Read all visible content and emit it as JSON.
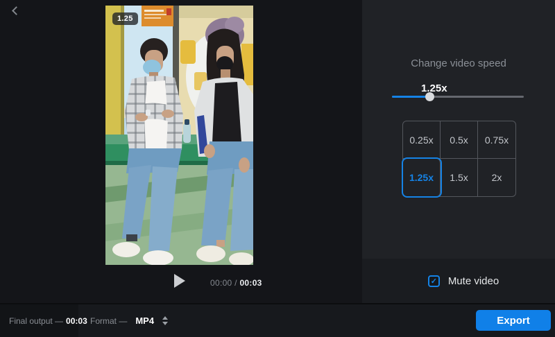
{
  "colors": {
    "accent": "#1583e6",
    "export_blue": "#1080e8"
  },
  "toolbar": {
    "back_icon_glyph": "‹"
  },
  "preview": {
    "speed_badge": "1.25",
    "player": {
      "play_icon_glyph": "▶",
      "current_time": "00:00",
      "separator": "/",
      "total_time": "00:03"
    }
  },
  "sidebar": {
    "title": "Change video speed",
    "slider": {
      "value_label": "1.25x",
      "fill_percent": 29
    },
    "speed_options": [
      {
        "label": "0.25x",
        "selected": false
      },
      {
        "label": "0.5x",
        "selected": false
      },
      {
        "label": "0.75x",
        "selected": false
      },
      {
        "label": "1.25x",
        "selected": true
      },
      {
        "label": "1.5x",
        "selected": false
      },
      {
        "label": "2x",
        "selected": false
      }
    ],
    "mute": {
      "label": "Mute video",
      "checked": true,
      "check_glyph": "✓"
    }
  },
  "footer": {
    "final_output_label": "Final output —",
    "final_output_value": "00:03",
    "format_label": "Format —",
    "format_value": "MP4",
    "export_label": "Export"
  }
}
